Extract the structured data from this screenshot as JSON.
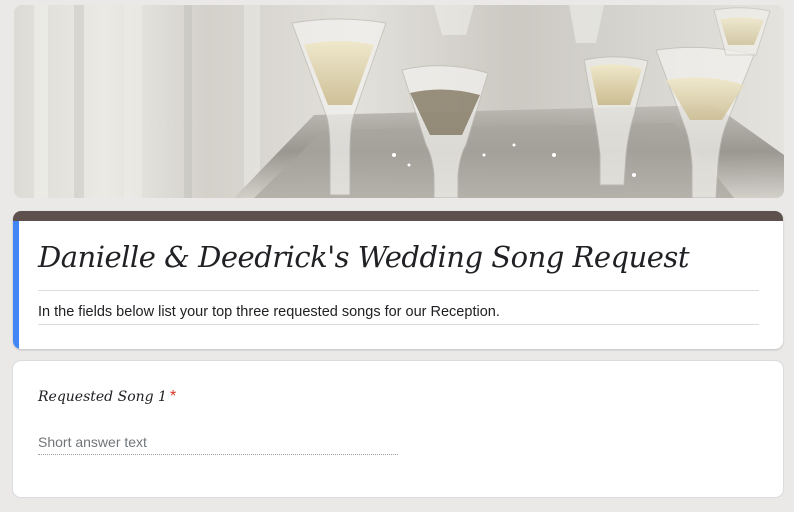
{
  "header": {
    "banner_image": "champagne-glasses-image"
  },
  "form": {
    "title": "Danielle & Deedrick's Wedding Song Request",
    "description": "In the fields below list your top three requested songs for our Reception."
  },
  "questions": [
    {
      "label": "Requested Song 1",
      "required_marker": "*",
      "placeholder": "Short answer text",
      "value": ""
    }
  ],
  "colors": {
    "theme_band": "#5e514d",
    "focus_bar": "#4285f4",
    "required": "#d93025",
    "background": "#ebe9e8"
  }
}
